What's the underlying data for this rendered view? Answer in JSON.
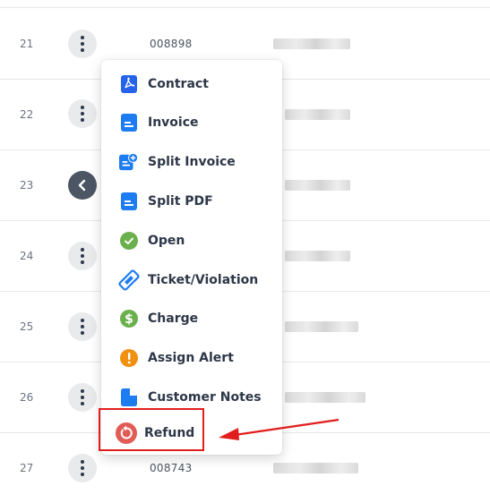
{
  "rows": [
    {
      "num": "21",
      "id": "008898"
    },
    {
      "num": "22",
      "id": ""
    },
    {
      "num": "23",
      "id": ""
    },
    {
      "num": "24",
      "id": ""
    },
    {
      "num": "25",
      "id": ""
    },
    {
      "num": "26",
      "id": ""
    },
    {
      "num": "27",
      "id": "008743"
    }
  ],
  "menu": {
    "items": [
      {
        "label": "Contract",
        "icon": "pdf-file-icon",
        "color": "#2563eb"
      },
      {
        "label": "Invoice",
        "icon": "document-icon",
        "color": "#1d7cf2"
      },
      {
        "label": "Split Invoice",
        "icon": "split-invoice-icon",
        "color": "#1d7cf2"
      },
      {
        "label": "Split PDF",
        "icon": "document-icon",
        "color": "#1d7cf2"
      },
      {
        "label": "Open",
        "icon": "check-circle-icon",
        "color": "#6ab04c"
      },
      {
        "label": "Ticket/Violation",
        "icon": "ticket-icon",
        "color": "#1d7cf2"
      },
      {
        "label": "Charge",
        "icon": "dollar-circle-icon",
        "color": "#6ab04c"
      },
      {
        "label": "Assign Alert",
        "icon": "alert-circle-icon",
        "color": "#f29111"
      },
      {
        "label": "Customer Notes",
        "icon": "note-icon",
        "color": "#1d7cf2"
      },
      {
        "label": "Refund",
        "icon": "refund-icon",
        "color": "#e25c57"
      }
    ]
  },
  "annotation": {
    "highlight_color": "#e21d1d"
  }
}
